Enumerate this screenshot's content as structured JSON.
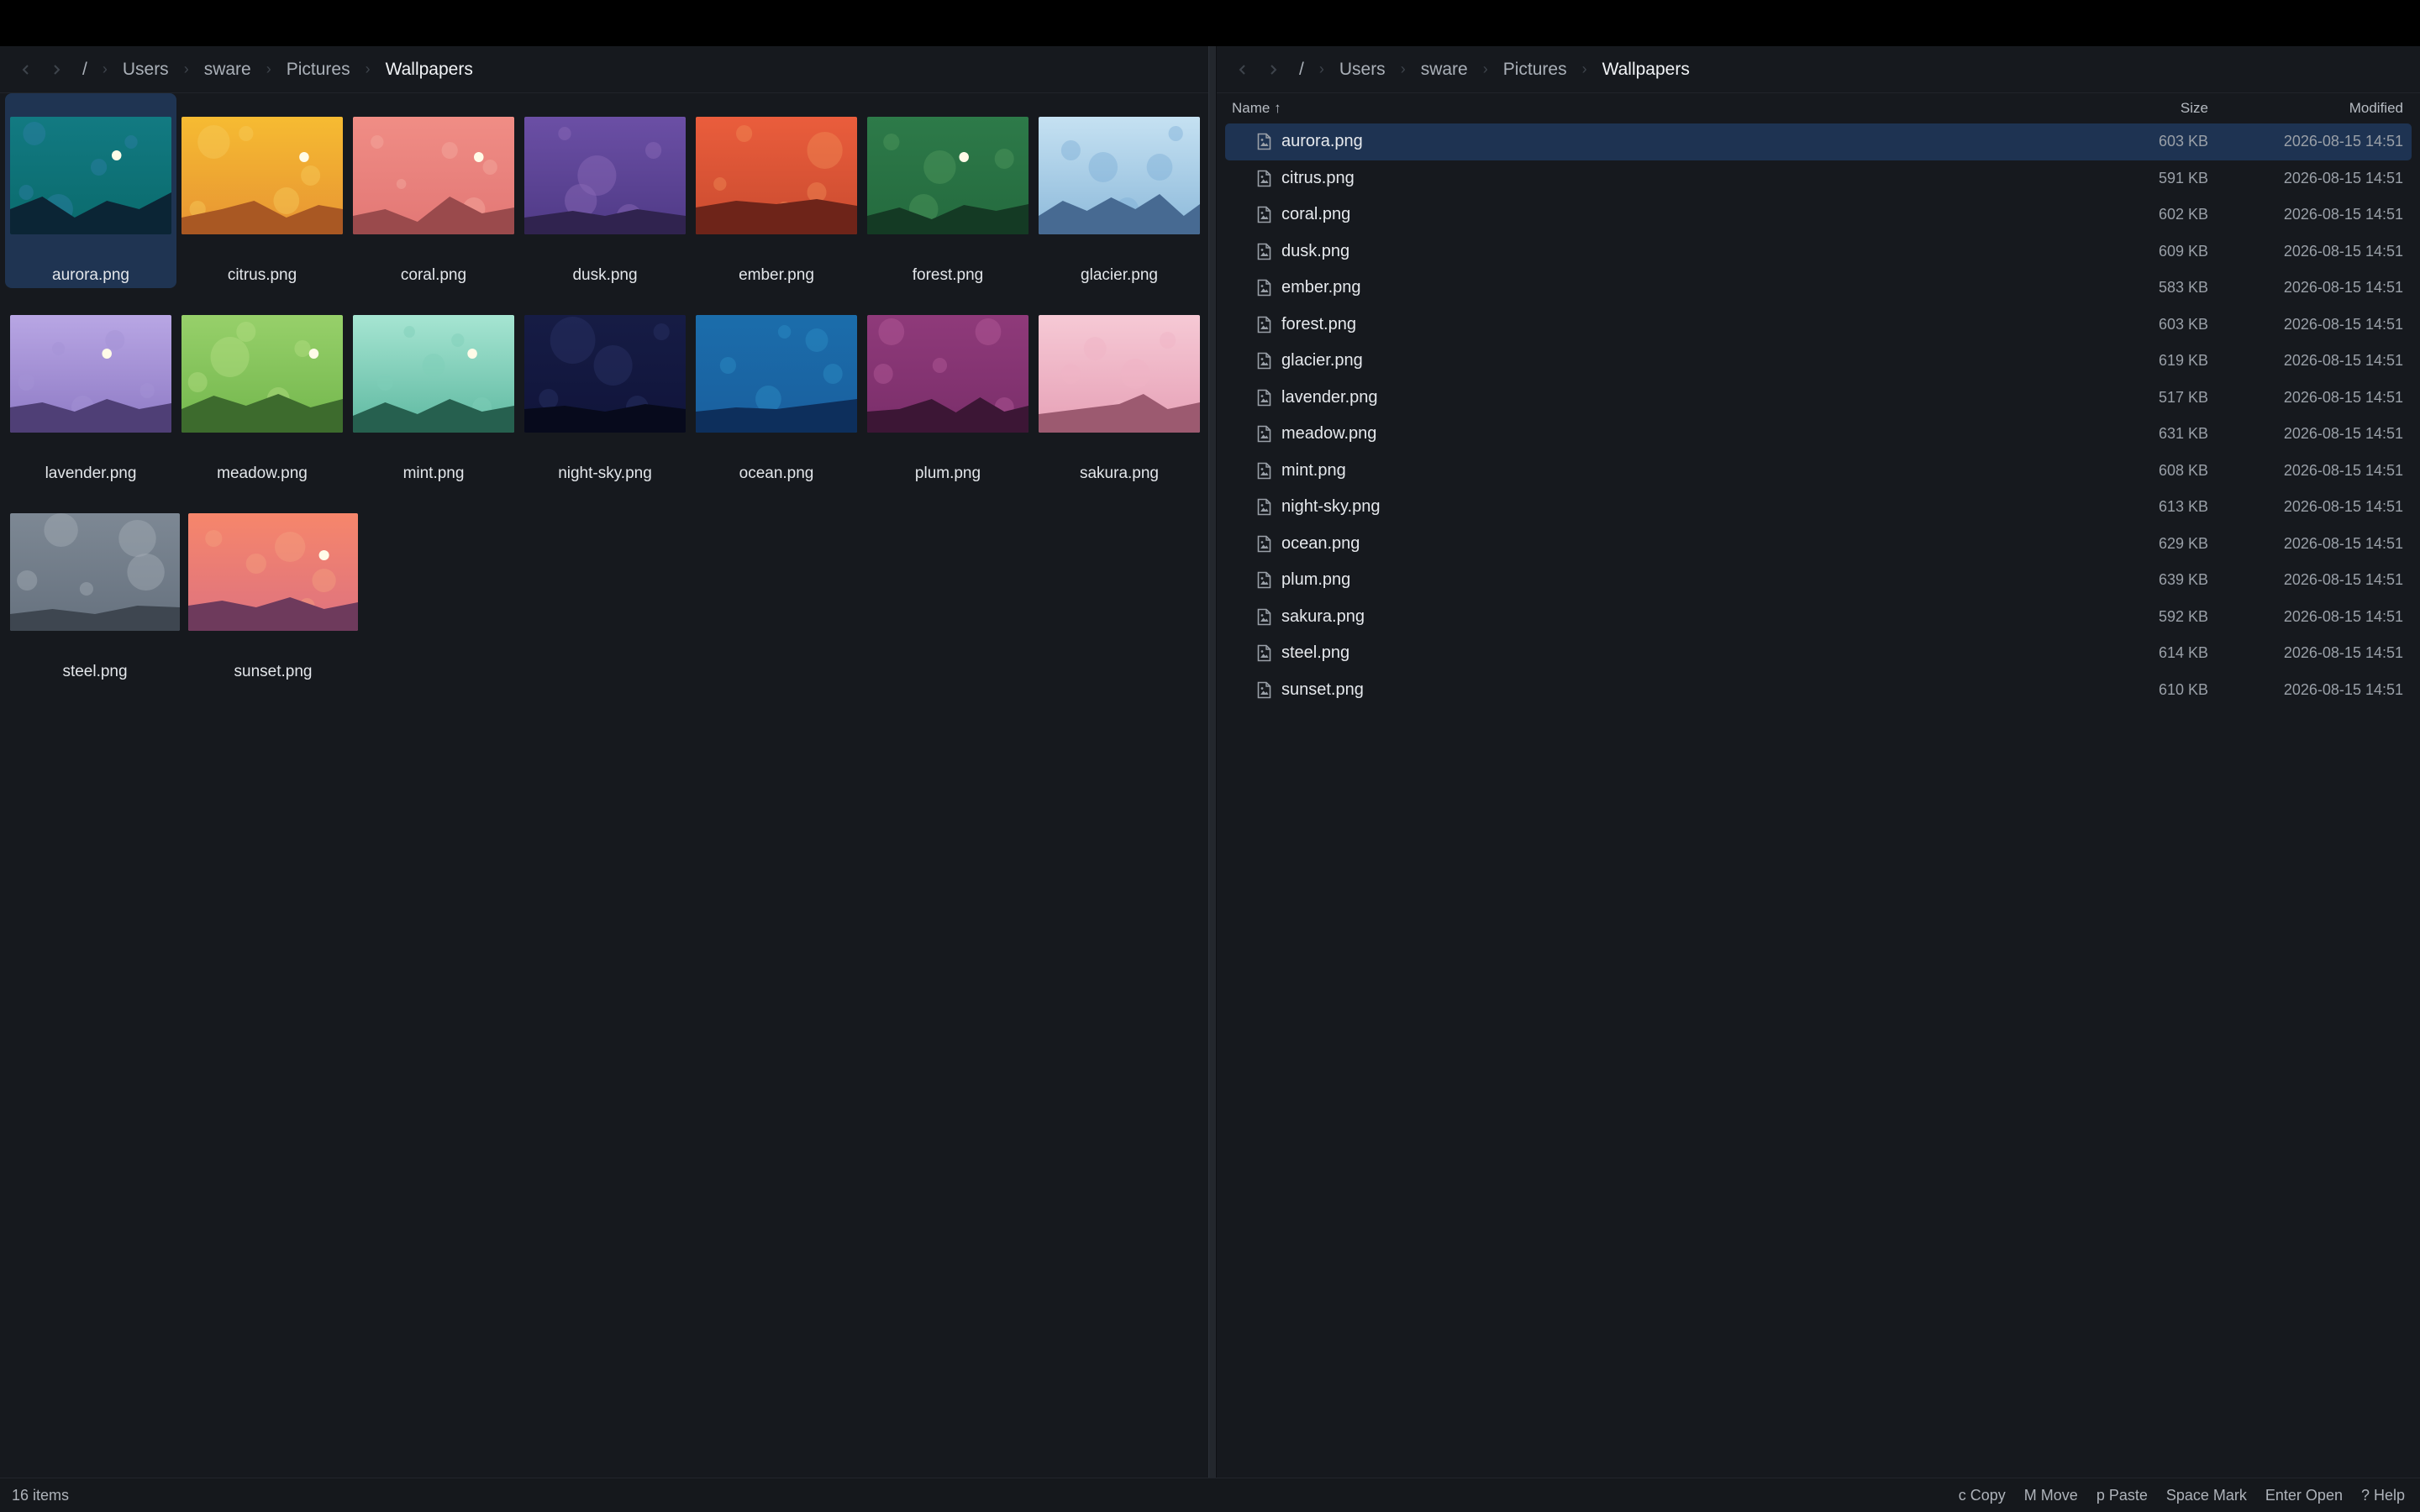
{
  "path": {
    "root": "/",
    "segments": [
      "Users",
      "sware",
      "Pictures",
      "Wallpapers"
    ]
  },
  "files": [
    {
      "name": "aurora.png",
      "size": "603 KB",
      "modified": "2026-08-15 14:51",
      "selected": true,
      "colors": {
        "top": "#127a82",
        "bottom": "#0a6a6c",
        "hill": "#0b2535",
        "bubble": "#2f7fa7",
        "sun": true
      }
    },
    {
      "name": "citrus.png",
      "size": "591 KB",
      "modified": "2026-08-15 14:51",
      "colors": {
        "top": "#f6bb32",
        "bottom": "#e79433",
        "hill": "#a95823",
        "bubble": "#f7c958",
        "sun": true
      }
    },
    {
      "name": "coral.png",
      "size": "602 KB",
      "modified": "2026-08-15 14:51",
      "colors": {
        "top": "#f08d85",
        "bottom": "#e27775",
        "hill": "#9a4a4c",
        "bubble": "#f4aaa0",
        "sun": true
      }
    },
    {
      "name": "dusk.png",
      "size": "609 KB",
      "modified": "2026-08-15 14:51",
      "colors": {
        "top": "#6b4fa5",
        "bottom": "#4f3a86",
        "hill": "#30234f",
        "bubble": "#8b6ab8",
        "sun": false
      }
    },
    {
      "name": "ember.png",
      "size": "583 KB",
      "modified": "2026-08-15 14:51",
      "colors": {
        "top": "#ea5d3c",
        "bottom": "#c94b2f",
        "hill": "#6e2419",
        "bubble": "#f08a55",
        "sun": false
      }
    },
    {
      "name": "forest.png",
      "size": "603 KB",
      "modified": "2026-08-15 14:51",
      "colors": {
        "top": "#2d7a49",
        "bottom": "#246a3e",
        "hill": "#143a24",
        "bubble": "#4f9a5e",
        "sun": true
      }
    },
    {
      "name": "glacier.png",
      "size": "619 KB",
      "modified": "2026-08-15 14:51",
      "colors": {
        "top": "#c5e1f2",
        "bottom": "#8cb9da",
        "hill": "#476a92",
        "bubble": "#7fb0d6",
        "sun": false
      }
    },
    {
      "name": "lavender.png",
      "size": "517 KB",
      "modified": "2026-08-15 14:51",
      "colors": {
        "top": "#b8a6e4",
        "bottom": "#8d79c4",
        "hill": "#4f3f76",
        "bubble": "#a592d5",
        "sun": true
      }
    },
    {
      "name": "meadow.png",
      "size": "631 KB",
      "modified": "2026-08-15 14:51",
      "colors": {
        "top": "#97d06a",
        "bottom": "#72b64c",
        "hill": "#3d6b2d",
        "bubble": "#b4dd82",
        "sun": true
      }
    },
    {
      "name": "mint.png",
      "size": "608 KB",
      "modified": "2026-08-15 14:51",
      "colors": {
        "top": "#a6e5d2",
        "bottom": "#5db8a0",
        "hill": "#26604f",
        "bubble": "#7fcfb8",
        "sun": true
      }
    },
    {
      "name": "night-sky.png",
      "size": "613 KB",
      "modified": "2026-08-15 14:51",
      "colors": {
        "top": "#161c45",
        "bottom": "#10143a",
        "hill": "#070a1c",
        "bubble": "#2a3266",
        "sun": false
      }
    },
    {
      "name": "ocean.png",
      "size": "629 KB",
      "modified": "2026-08-15 14:51",
      "colors": {
        "top": "#1b6dab",
        "bottom": "#1a5f9e",
        "hill": "#0d2f5c",
        "bubble": "#2d8fc6",
        "sun": false
      }
    },
    {
      "name": "plum.png",
      "size": "639 KB",
      "modified": "2026-08-15 14:51",
      "colors": {
        "top": "#8f3a7a",
        "bottom": "#7a2e6a",
        "hill": "#3c1635",
        "bubble": "#b35a99",
        "sun": false
      }
    },
    {
      "name": "sakura.png",
      "size": "592 KB",
      "modified": "2026-08-15 14:51",
      "colors": {
        "top": "#f6c9d5",
        "bottom": "#e6a0b6",
        "hill": "#9c5a70",
        "bubble": "#f0b4c6",
        "sun": false
      }
    },
    {
      "name": "steel.png",
      "size": "614 KB",
      "modified": "2026-08-15 14:51",
      "colors": {
        "top": "#7d8894",
        "bottom": "#66717e",
        "hill": "#3e4650",
        "bubble": "#a3acb6",
        "sun": false
      }
    },
    {
      "name": "sunset.png",
      "size": "610 KB",
      "modified": "2026-08-15 14:51",
      "colors": {
        "top": "#f6866b",
        "bottom": "#dd7280",
        "hill": "#6e3a5c",
        "bubble": "#f4a07f",
        "sun": true
      }
    }
  ],
  "list_header": {
    "name": "Name ↑",
    "size": "Size",
    "modified": "Modified"
  },
  "status": {
    "count": "16 items",
    "hints": [
      "c Copy",
      "M Move",
      "p Paste",
      "Space Mark",
      "Enter Open",
      "? Help"
    ]
  },
  "theme": {
    "accent": "#1f3452",
    "background": "#16191e"
  }
}
